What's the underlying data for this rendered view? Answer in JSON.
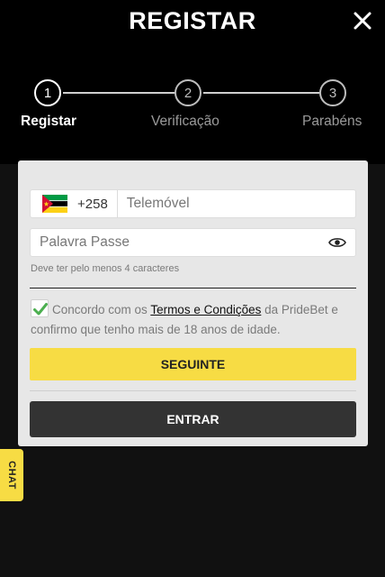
{
  "header": {
    "title": "REGISTAR",
    "close_icon": "close-icon"
  },
  "stepper": {
    "steps": [
      {
        "number": "1",
        "label": "Registar",
        "active": true
      },
      {
        "number": "2",
        "label": "Verificação",
        "active": false
      },
      {
        "number": "3",
        "label": "Parabéns",
        "active": false
      }
    ]
  },
  "form": {
    "phone": {
      "country_flag": "mozambique-flag-icon",
      "dial_code": "+258",
      "placeholder": "Telemóvel",
      "value": ""
    },
    "password": {
      "placeholder": "Palavra Passe",
      "value": "",
      "toggle_icon": "eye-icon",
      "hint": "Deve ter pelo menos 4 caracteres"
    },
    "terms": {
      "checked": true,
      "prefix": "Concordo com os ",
      "link": "Termos e Condições",
      "suffix": " da PrideBet e confirmo que tenho mais de 18 anos de idade."
    },
    "next_label": "SEGUINTE",
    "login_label": "ENTRAR"
  },
  "chat_tab": {
    "label": "CHAT"
  },
  "colors": {
    "accent": "#f7dc44",
    "checkbox_check": "#4caf50",
    "dark_button": "#333333",
    "card": "#e7e7e7"
  }
}
